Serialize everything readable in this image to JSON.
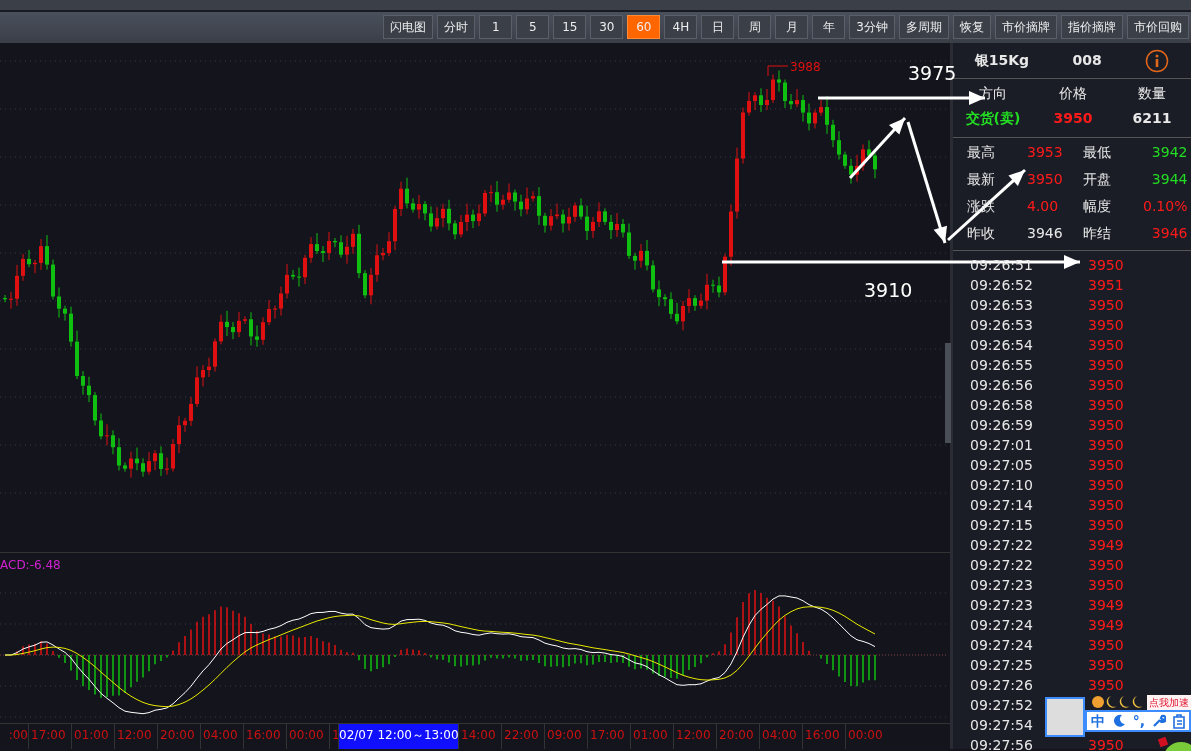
{
  "toolbar": {
    "buttons": [
      {
        "label": "闪电图",
        "selected": false
      },
      {
        "label": "分时",
        "selected": false
      },
      {
        "label": "1",
        "selected": false
      },
      {
        "label": "5",
        "selected": false
      },
      {
        "label": "15",
        "selected": false
      },
      {
        "label": "30",
        "selected": false
      },
      {
        "label": "60",
        "selected": true
      },
      {
        "label": "4H",
        "selected": false
      },
      {
        "label": "日",
        "selected": false
      },
      {
        "label": "周",
        "selected": false
      },
      {
        "label": "月",
        "selected": false
      },
      {
        "label": "年",
        "selected": false
      },
      {
        "label": "3分钟",
        "selected": false
      },
      {
        "label": "多周期",
        "selected": false
      },
      {
        "label": "恢复",
        "selected": false
      },
      {
        "label": "市价摘牌",
        "selected": false
      },
      {
        "label": "指价摘牌",
        "selected": false
      },
      {
        "label": "市价回购",
        "selected": false
      }
    ]
  },
  "main_chart": {
    "peak_label": "3988",
    "annotations": [
      {
        "text": "3975",
        "kind": "upper"
      },
      {
        "text": "3910",
        "kind": "lower"
      }
    ]
  },
  "macd": {
    "label": "ACD:-6.48"
  },
  "time_axis": {
    "labels": [
      {
        "text": ":00",
        "kind": "tick"
      },
      {
        "text": "17:00",
        "kind": "tick"
      },
      {
        "text": "01:00",
        "kind": "tick"
      },
      {
        "text": "12:00",
        "kind": "tick"
      },
      {
        "text": "20:00",
        "kind": "tick"
      },
      {
        "text": "04:00",
        "kind": "tick"
      },
      {
        "text": "16:00",
        "kind": "tick"
      },
      {
        "text": "00:00",
        "kind": "tick"
      },
      {
        "text": "1",
        "kind": "cut"
      },
      {
        "text": "02/07 12:00～13:00",
        "kind": "cursor"
      },
      {
        "text": "14:00",
        "kind": "tick"
      },
      {
        "text": "22:00",
        "kind": "tick"
      },
      {
        "text": "09:00",
        "kind": "tick"
      },
      {
        "text": "17:00",
        "kind": "tick"
      },
      {
        "text": "01:00",
        "kind": "tick"
      },
      {
        "text": "12:00",
        "kind": "tick"
      },
      {
        "text": "20:00",
        "kind": "tick"
      },
      {
        "text": "04:00",
        "kind": "tick"
      },
      {
        "text": "16:00",
        "kind": "tick"
      },
      {
        "text": "00:00",
        "kind": "tick"
      }
    ]
  },
  "quote_panel": {
    "name": "银15Kg",
    "code": "008",
    "headers": [
      "方向",
      "价格",
      "数量"
    ],
    "trade": {
      "direction": "交货(卖)",
      "price": "3950",
      "quantity": "6211"
    },
    "stats": [
      {
        "label": "最高",
        "value": "3953",
        "color": "#ff1a1a"
      },
      {
        "label": "最低",
        "value": "3942",
        "color": "#22dd22"
      },
      {
        "label": "最新",
        "value": "3950",
        "color": "#ff1a1a"
      },
      {
        "label": "开盘",
        "value": "3944",
        "color": "#22dd22"
      },
      {
        "label": "涨跌",
        "value": "4.00",
        "color": "#ff1a1a"
      },
      {
        "label": "幅度",
        "value": "0.10%",
        "color": "#ff1a1a"
      },
      {
        "label": "昨收",
        "value": "3946",
        "color": "#e8e8e8"
      },
      {
        "label": "昨结",
        "value": "3946",
        "color": "#ff1a1a"
      }
    ]
  },
  "ticks": [
    {
      "time": "09:26:51",
      "price": "3950"
    },
    {
      "time": "09:26:52",
      "price": "3951"
    },
    {
      "time": "09:26:53",
      "price": "3950"
    },
    {
      "time": "09:26:53",
      "price": "3950"
    },
    {
      "time": "09:26:54",
      "price": "3950"
    },
    {
      "time": "09:26:55",
      "price": "3950"
    },
    {
      "time": "09:26:56",
      "price": "3950"
    },
    {
      "time": "09:26:58",
      "price": "3950"
    },
    {
      "time": "09:26:59",
      "price": "3950"
    },
    {
      "time": "09:27:01",
      "price": "3950"
    },
    {
      "time": "09:27:05",
      "price": "3950"
    },
    {
      "time": "09:27:10",
      "price": "3950"
    },
    {
      "time": "09:27:14",
      "price": "3950"
    },
    {
      "time": "09:27:15",
      "price": "3950"
    },
    {
      "time": "09:27:22",
      "price": "3949"
    },
    {
      "time": "09:27:22",
      "price": "3950"
    },
    {
      "time": "09:27:23",
      "price": "3950"
    },
    {
      "time": "09:27:23",
      "price": "3949"
    },
    {
      "time": "09:27:24",
      "price": "3949"
    },
    {
      "time": "09:27:24",
      "price": "3950"
    },
    {
      "time": "09:27:25",
      "price": "3950"
    },
    {
      "time": "09:27:26",
      "price": "3950"
    },
    {
      "time": "09:27:52"
    },
    {
      "time": "09:27:54"
    },
    {
      "time": "09:27:56",
      "price": "3950"
    }
  ],
  "ime_toolbar": {
    "mode": "中",
    "punctuation": "°,",
    "promo": "点我加速"
  }
}
